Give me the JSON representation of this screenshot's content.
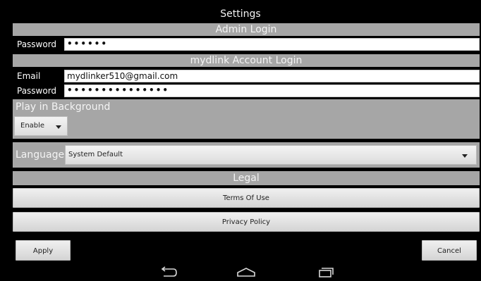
{
  "header": {
    "title": "Settings"
  },
  "admin": {
    "section_label": "Admin Login",
    "password_label": "Password",
    "password_value": "••••••"
  },
  "mydlink": {
    "section_label": "mydlink Account Login",
    "email_label": "Email",
    "email_value": "mydlinker510@gmail.com",
    "password_label": "Password",
    "password_value": "•••••••••••••••"
  },
  "background": {
    "label": "Play in Background",
    "selected": "Enable"
  },
  "language": {
    "label": "Language",
    "selected": "System Default"
  },
  "legal": {
    "section_label": "Legal",
    "terms_label": "Terms Of Use",
    "privacy_label": "Privacy Policy"
  },
  "footer": {
    "apply_label": "Apply",
    "cancel_label": "Cancel"
  },
  "navbar": {
    "icons": [
      "back-icon",
      "home-icon",
      "recent-apps-icon"
    ]
  },
  "colors": {
    "background": "#000000",
    "section_gray": "#a6a6a6",
    "field_white": "#ffffff"
  }
}
